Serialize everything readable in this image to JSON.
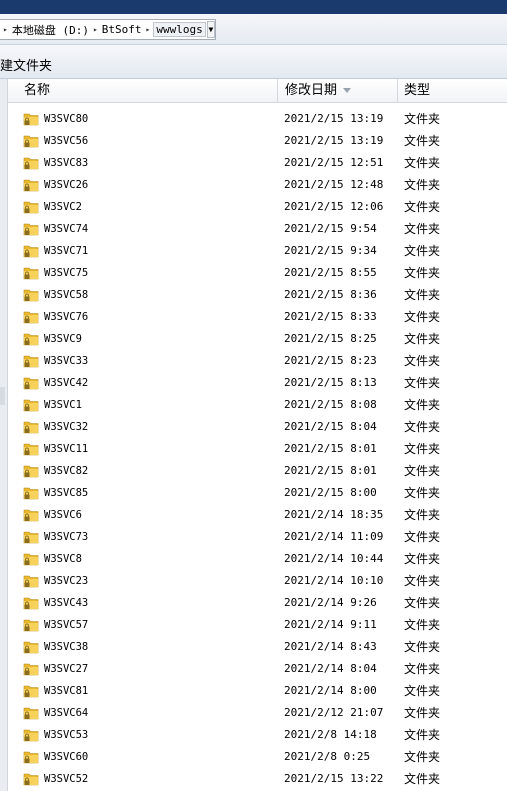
{
  "address": {
    "crumbs": [
      "本地磁盘 (D:)",
      "BtSoft",
      "wwwlogs"
    ]
  },
  "toolbar": {
    "new_folder_label": "建文件夹"
  },
  "columns": {
    "name": "名称",
    "date": "修改日期",
    "type": "类型"
  },
  "rows": [
    {
      "name": "W3SVC80",
      "date": "2021/2/15 13:19",
      "type": "文件夹"
    },
    {
      "name": "W3SVC56",
      "date": "2021/2/15 13:19",
      "type": "文件夹"
    },
    {
      "name": "W3SVC83",
      "date": "2021/2/15 12:51",
      "type": "文件夹"
    },
    {
      "name": "W3SVC26",
      "date": "2021/2/15 12:48",
      "type": "文件夹"
    },
    {
      "name": "W3SVC2",
      "date": "2021/2/15 12:06",
      "type": "文件夹"
    },
    {
      "name": "W3SVC74",
      "date": "2021/2/15 9:54",
      "type": "文件夹"
    },
    {
      "name": "W3SVC71",
      "date": "2021/2/15 9:34",
      "type": "文件夹"
    },
    {
      "name": "W3SVC75",
      "date": "2021/2/15 8:55",
      "type": "文件夹"
    },
    {
      "name": "W3SVC58",
      "date": "2021/2/15 8:36",
      "type": "文件夹"
    },
    {
      "name": "W3SVC76",
      "date": "2021/2/15 8:33",
      "type": "文件夹"
    },
    {
      "name": "W3SVC9",
      "date": "2021/2/15 8:25",
      "type": "文件夹"
    },
    {
      "name": "W3SVC33",
      "date": "2021/2/15 8:23",
      "type": "文件夹"
    },
    {
      "name": "W3SVC42",
      "date": "2021/2/15 8:13",
      "type": "文件夹"
    },
    {
      "name": "W3SVC1",
      "date": "2021/2/15 8:08",
      "type": "文件夹"
    },
    {
      "name": "W3SVC32",
      "date": "2021/2/15 8:04",
      "type": "文件夹"
    },
    {
      "name": "W3SVC11",
      "date": "2021/2/15 8:01",
      "type": "文件夹"
    },
    {
      "name": "W3SVC82",
      "date": "2021/2/15 8:01",
      "type": "文件夹"
    },
    {
      "name": "W3SVC85",
      "date": "2021/2/15 8:00",
      "type": "文件夹"
    },
    {
      "name": "W3SVC6",
      "date": "2021/2/14 18:35",
      "type": "文件夹"
    },
    {
      "name": "W3SVC73",
      "date": "2021/2/14 11:09",
      "type": "文件夹"
    },
    {
      "name": "W3SVC8",
      "date": "2021/2/14 10:44",
      "type": "文件夹"
    },
    {
      "name": "W3SVC23",
      "date": "2021/2/14 10:10",
      "type": "文件夹"
    },
    {
      "name": "W3SVC43",
      "date": "2021/2/14 9:26",
      "type": "文件夹"
    },
    {
      "name": "W3SVC57",
      "date": "2021/2/14 9:11",
      "type": "文件夹"
    },
    {
      "name": "W3SVC38",
      "date": "2021/2/14 8:43",
      "type": "文件夹"
    },
    {
      "name": "W3SVC27",
      "date": "2021/2/14 8:04",
      "type": "文件夹"
    },
    {
      "name": "W3SVC81",
      "date": "2021/2/14 8:00",
      "type": "文件夹"
    },
    {
      "name": "W3SVC64",
      "date": "2021/2/12 21:07",
      "type": "文件夹"
    },
    {
      "name": "W3SVC53",
      "date": "2021/2/8 14:18",
      "type": "文件夹"
    },
    {
      "name": "W3SVC60",
      "date": "2021/2/8 0:25",
      "type": "文件夹"
    },
    {
      "name": "W3SVC52",
      "date": "2021/2/15 13:22",
      "type": "文件夹"
    }
  ],
  "colors": {
    "folder": "#e8b830",
    "lock": "#8a6d1f",
    "titlebar": "#1a3a6e"
  },
  "icons": {
    "folder": "locked-folder-icon"
  }
}
